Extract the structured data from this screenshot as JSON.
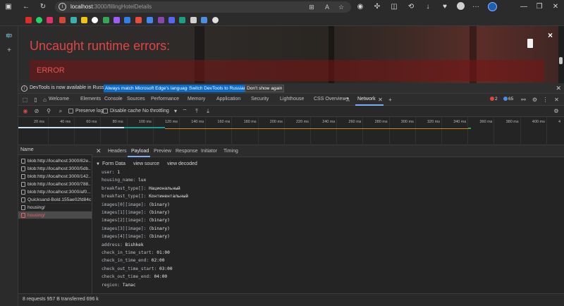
{
  "browser": {
    "url_host": "localhost",
    "url_rest": ":3000/fillingHotelDetails"
  },
  "page": {
    "error_title": "Uncaught runtime errors:",
    "error_label": "ERROR",
    "close_glyph": "×"
  },
  "infobar": {
    "text": "DevTools is now available in Russian!",
    "btn_match": "Always match Microsoft Edge's language",
    "btn_switch": "Switch DevTools to Russian",
    "btn_dont": "Don't show again"
  },
  "devtools": {
    "tabs": [
      "Welcome",
      "Elements",
      "Console",
      "Sources",
      "Performance",
      "Memory",
      "Application",
      "Security",
      "Lighthouse",
      "CSS Overview",
      "Network"
    ],
    "error_count": "2",
    "message_count": "65"
  },
  "network_toolbar": {
    "preserve_log": "Preserve log",
    "disable_cache": "Disable cache",
    "throttling": "No throttling"
  },
  "timeline": {
    "ticks": [
      "20 ms",
      "40 ms",
      "60 ms",
      "80 ms",
      "100 ms",
      "120 ms",
      "140 ms",
      "160 ms",
      "180 ms",
      "200 ms",
      "220 ms",
      "240 ms",
      "260 ms",
      "280 ms",
      "300 ms",
      "320 ms",
      "340 ms",
      "360 ms",
      "380 ms",
      "400 ms",
      "4"
    ]
  },
  "requests": {
    "header": "Name",
    "rows": [
      "blob:http://localhost:3000/82e...",
      "blob:http://localhost:3000/5db...",
      "blob:http://localhost:3000/142...",
      "blob:http://localhost:3000/788...",
      "blob:http://localhost:3000/af0...",
      "Quicksand-Bold.155ae02fd84c...",
      "housing/",
      "housing/"
    ]
  },
  "details": {
    "tabs": [
      "Headers",
      "Payload",
      "Preview",
      "Response",
      "Initiator",
      "Timing"
    ],
    "section_title": "Form Data",
    "view_source": "view source",
    "view_decoded": "view decoded",
    "fields": [
      {
        "key": "user:",
        "value": "1"
      },
      {
        "key": "housing_name:",
        "value": "lux"
      },
      {
        "key": "breakfast_type[]:",
        "value": "Национальный"
      },
      {
        "key": "breakfast_type[]:",
        "value": "Континентальный"
      },
      {
        "key": "images[0][image]:",
        "value": "(binary)"
      },
      {
        "key": "images[1][image]:",
        "value": "(binary)"
      },
      {
        "key": "images[2][image]:",
        "value": "(binary)"
      },
      {
        "key": "images[3][image]:",
        "value": "(binary)"
      },
      {
        "key": "images[4][image]:",
        "value": "(binary)"
      },
      {
        "key": "address:",
        "value": "Bishkek"
      },
      {
        "key": "check_in_time_start:",
        "value": "01:00"
      },
      {
        "key": "check_in_time_end:",
        "value": "02:00"
      },
      {
        "key": "check_out_time_start:",
        "value": "03:00"
      },
      {
        "key": "check_out_time_end:",
        "value": "04:00"
      },
      {
        "key": "region:",
        "value": "Талас"
      }
    ]
  },
  "status": {
    "text": "8 requests  957 B transferred  696 k"
  },
  "colors": {
    "accent": "#7cacf8",
    "error": "#e04444",
    "button_blue": "#0e6ac9"
  }
}
